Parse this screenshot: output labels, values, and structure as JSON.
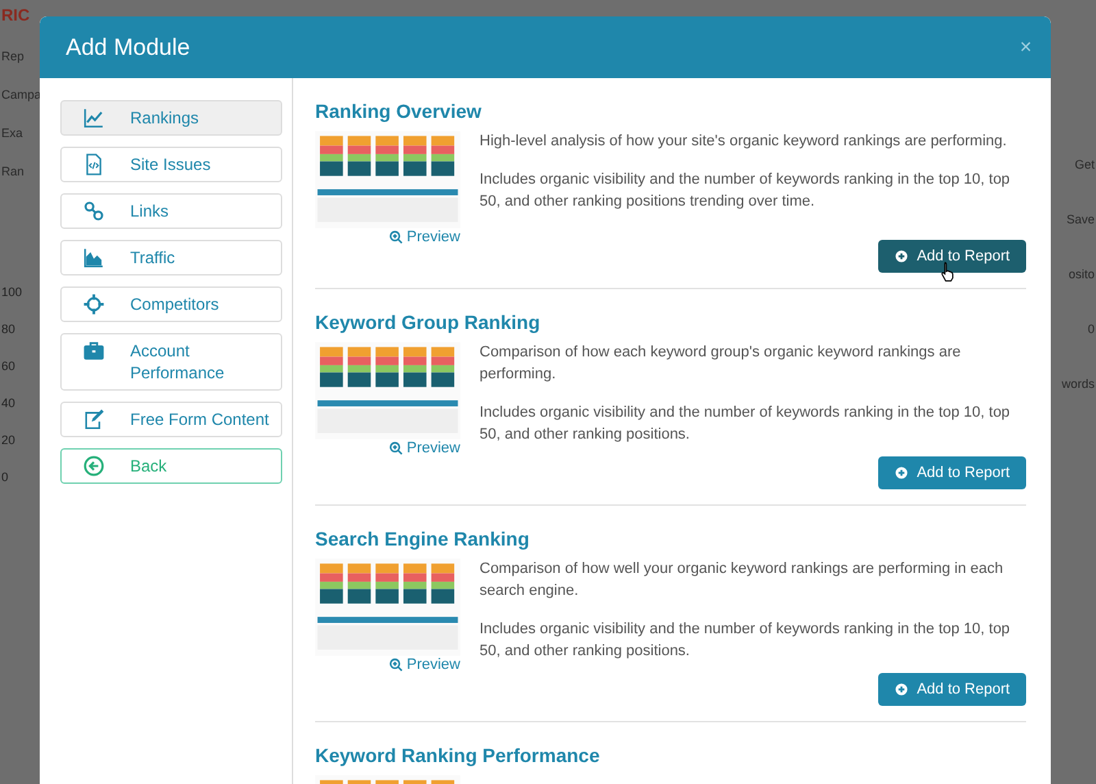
{
  "background": {
    "logo": "RIC",
    "left_texts": [
      "Rep",
      "Campa",
      "Exa",
      "Ran"
    ],
    "axis_ticks": [
      "100",
      "80",
      "60",
      "40",
      "20",
      "0"
    ],
    "right_texts": [
      "Get",
      "Save",
      "osito",
      "0",
      "words"
    ]
  },
  "modal": {
    "title": "Add Module",
    "close": "×",
    "sidebar": {
      "items": [
        {
          "label": "Rankings",
          "kind": "chart",
          "selected": true
        },
        {
          "label": "Site Issues",
          "kind": "code",
          "selected": false
        },
        {
          "label": "Links",
          "kind": "link",
          "selected": false
        },
        {
          "label": "Traffic",
          "kind": "area",
          "selected": false
        },
        {
          "label": "Competitors",
          "kind": "target",
          "selected": false
        },
        {
          "label": "Account Performance",
          "kind": "briefcase",
          "selected": false
        },
        {
          "label": "Free Form Content",
          "kind": "edit",
          "selected": false
        },
        {
          "label": "Back",
          "kind": "back",
          "selected": false
        }
      ]
    },
    "modules": [
      {
        "title": "Ranking Overview",
        "preview": "Preview",
        "descriptions": [
          "High-level analysis of how your site's organic keyword rankings are performing.",
          "Includes organic visibility and the number of keywords ranking in the top 10, top 50, and other ranking positions trending over time."
        ],
        "button": "Add to Report",
        "hovered": true
      },
      {
        "title": "Keyword Group Ranking",
        "preview": "Preview",
        "descriptions": [
          "Comparison of how each keyword group's organic keyword rankings are performing.",
          "Includes organic visibility and the number of keywords ranking in the top 10, top 50, and other ranking positions."
        ],
        "button": "Add to Report",
        "hovered": false
      },
      {
        "title": "Search Engine Ranking",
        "preview": "Preview",
        "descriptions": [
          "Comparison of how well your organic keyword rankings are performing in each search engine.",
          "Includes organic visibility and the number of keywords ranking in the top 10, top 50, and other ranking positions."
        ],
        "button": "Add to Report",
        "hovered": false
      },
      {
        "title": "Keyword Ranking Performance"
      }
    ]
  }
}
